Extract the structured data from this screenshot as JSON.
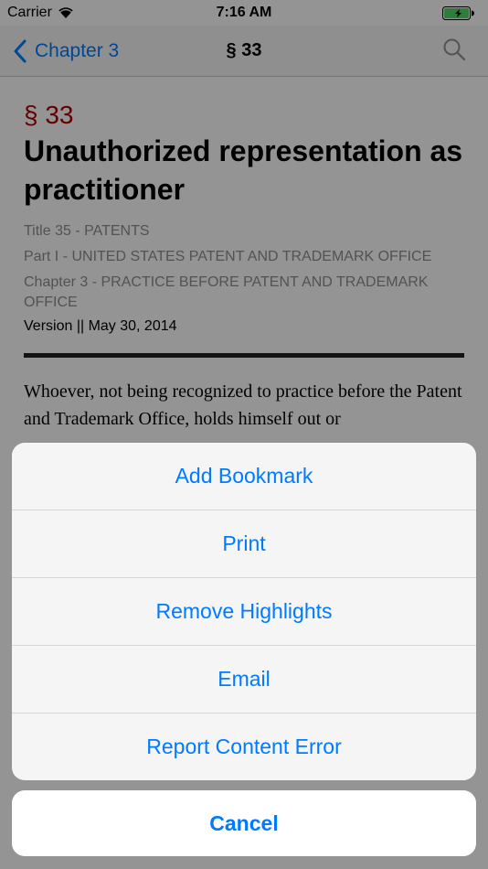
{
  "status": {
    "carrier": "Carrier",
    "time": "7:16 AM"
  },
  "nav": {
    "back_label": "Chapter 3",
    "title": "§ 33"
  },
  "section": {
    "number": "§ 33",
    "heading": "Unauthorized representation as practitioner",
    "title_line": "Title 35 - PATENTS",
    "part_line": "Part I - UNITED STATES PATENT AND TRADEMARK OFFICE",
    "chapter_line": "Chapter 3 - PRACTICE BEFORE PATENT AND TRADEMARK OFFICE",
    "version": "Version || May 30, 2014",
    "body": "Whoever, not being recognized to practice before the Patent and Trademark Office, holds himself out or"
  },
  "action_sheet": {
    "items": [
      {
        "label": "Add Bookmark"
      },
      {
        "label": "Print"
      },
      {
        "label": "Remove Highlights"
      },
      {
        "label": "Email"
      },
      {
        "label": "Report Content Error"
      }
    ],
    "cancel_label": "Cancel"
  },
  "colors": {
    "accent": "#007aff",
    "section_number": "#b00000"
  }
}
